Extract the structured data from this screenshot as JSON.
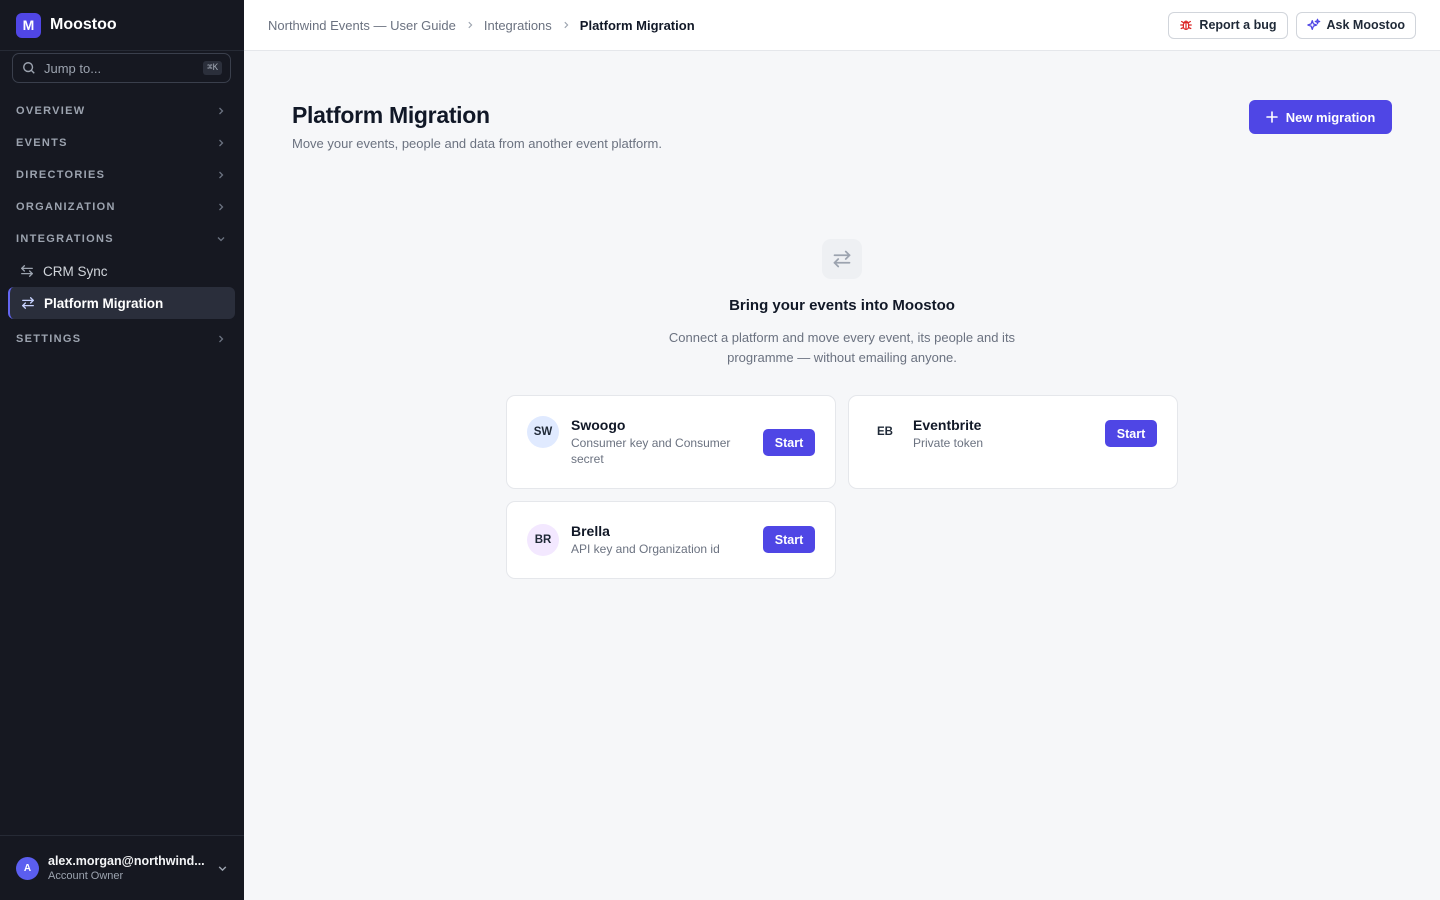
{
  "app": {
    "name": "Moostoo",
    "logo_letter": "M",
    "accent": "#4f46e5"
  },
  "search": {
    "placeholder": "Jump to...",
    "shortcut": "⌘K"
  },
  "sidebar": {
    "sections": [
      {
        "label": "OVERVIEW",
        "expanded": false
      },
      {
        "label": "EVENTS",
        "expanded": false
      },
      {
        "label": "DIRECTORIES",
        "expanded": false
      },
      {
        "label": "ORGANIZATION",
        "expanded": false
      },
      {
        "label": "INTEGRATIONS",
        "expanded": true,
        "items": [
          {
            "label": "CRM Sync",
            "icon": "sync-arrows-icon",
            "active": false
          },
          {
            "label": "Platform Migration",
            "icon": "swap-arrows-icon",
            "active": true
          }
        ]
      },
      {
        "label": "SETTINGS",
        "expanded": false
      }
    ]
  },
  "user": {
    "initial": "A",
    "email": "alex.morgan@northwind...",
    "role": "Account Owner"
  },
  "breadcrumb": [
    "Northwind Events — User Guide",
    "Integrations",
    "Platform Migration"
  ],
  "header_actions": {
    "report_bug": "Report a bug",
    "ask": "Ask Moostoo"
  },
  "page": {
    "title": "Platform Migration",
    "subtitle": "Move your events, people and data from another event platform.",
    "new_button": "New migration"
  },
  "empty_state": {
    "title": "Bring your events into Moostoo",
    "description": "Connect a platform and move every event, its people and its programme — without emailing anyone."
  },
  "platforms": [
    {
      "abbr": "SW",
      "name": "Swoogo",
      "credentials": "Consumer key and Consumer secret",
      "action": "Start",
      "logo_bg": "#e0eaff"
    },
    {
      "abbr": "EB",
      "name": "Eventbrite",
      "credentials": "Private token",
      "action": "Start",
      "logo_bg": "#ffffff"
    },
    {
      "abbr": "BR",
      "name": "Brella",
      "credentials": "API key and Organization id",
      "action": "Start",
      "logo_bg": "#f3e8ff"
    }
  ]
}
